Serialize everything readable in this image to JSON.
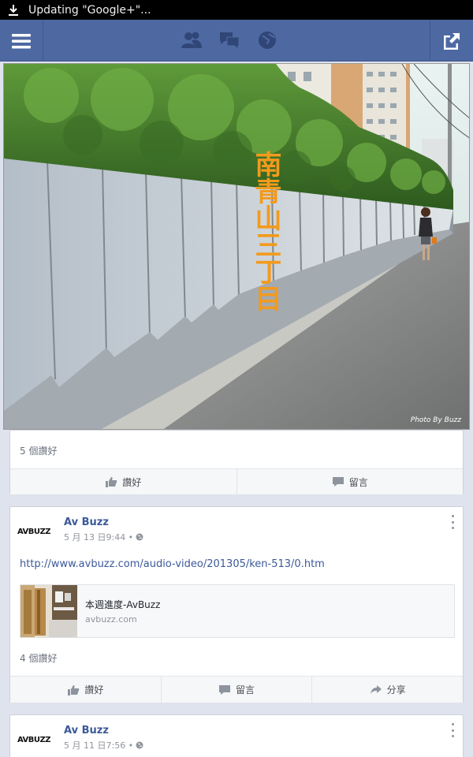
{
  "status_bar": {
    "text": "Updating \"Google+\"..."
  },
  "nav": {
    "icons": [
      "friends-icon",
      "messages-icon",
      "globe-icon"
    ]
  },
  "photo": {
    "title_chars": "南青山三丁目",
    "credit": "Photo By Buzz"
  },
  "post1": {
    "likes": "5 個讚好",
    "actions": {
      "like": "讚好",
      "comment": "留言"
    }
  },
  "post2": {
    "author": "Av Buzz",
    "avatar_text": "AVBUZZ",
    "time": "5 月 13 日9:44 •",
    "link": "http://www.avbuzz.com/audio-video/201305/ken-513/0.htm",
    "preview": {
      "title": "本週進度-AvBuzz",
      "domain": "avbuzz.com"
    },
    "likes": "4 個讚好",
    "actions": {
      "like": "讚好",
      "comment": "留言",
      "share": "分享"
    }
  },
  "post3": {
    "author": "Av Buzz",
    "avatar_text": "AVBUZZ",
    "time": "5 月 11 日7:56 •"
  },
  "colors": {
    "nav": "#4e69a2",
    "link": "#3b5998",
    "title_orange": "#f39a1c"
  }
}
